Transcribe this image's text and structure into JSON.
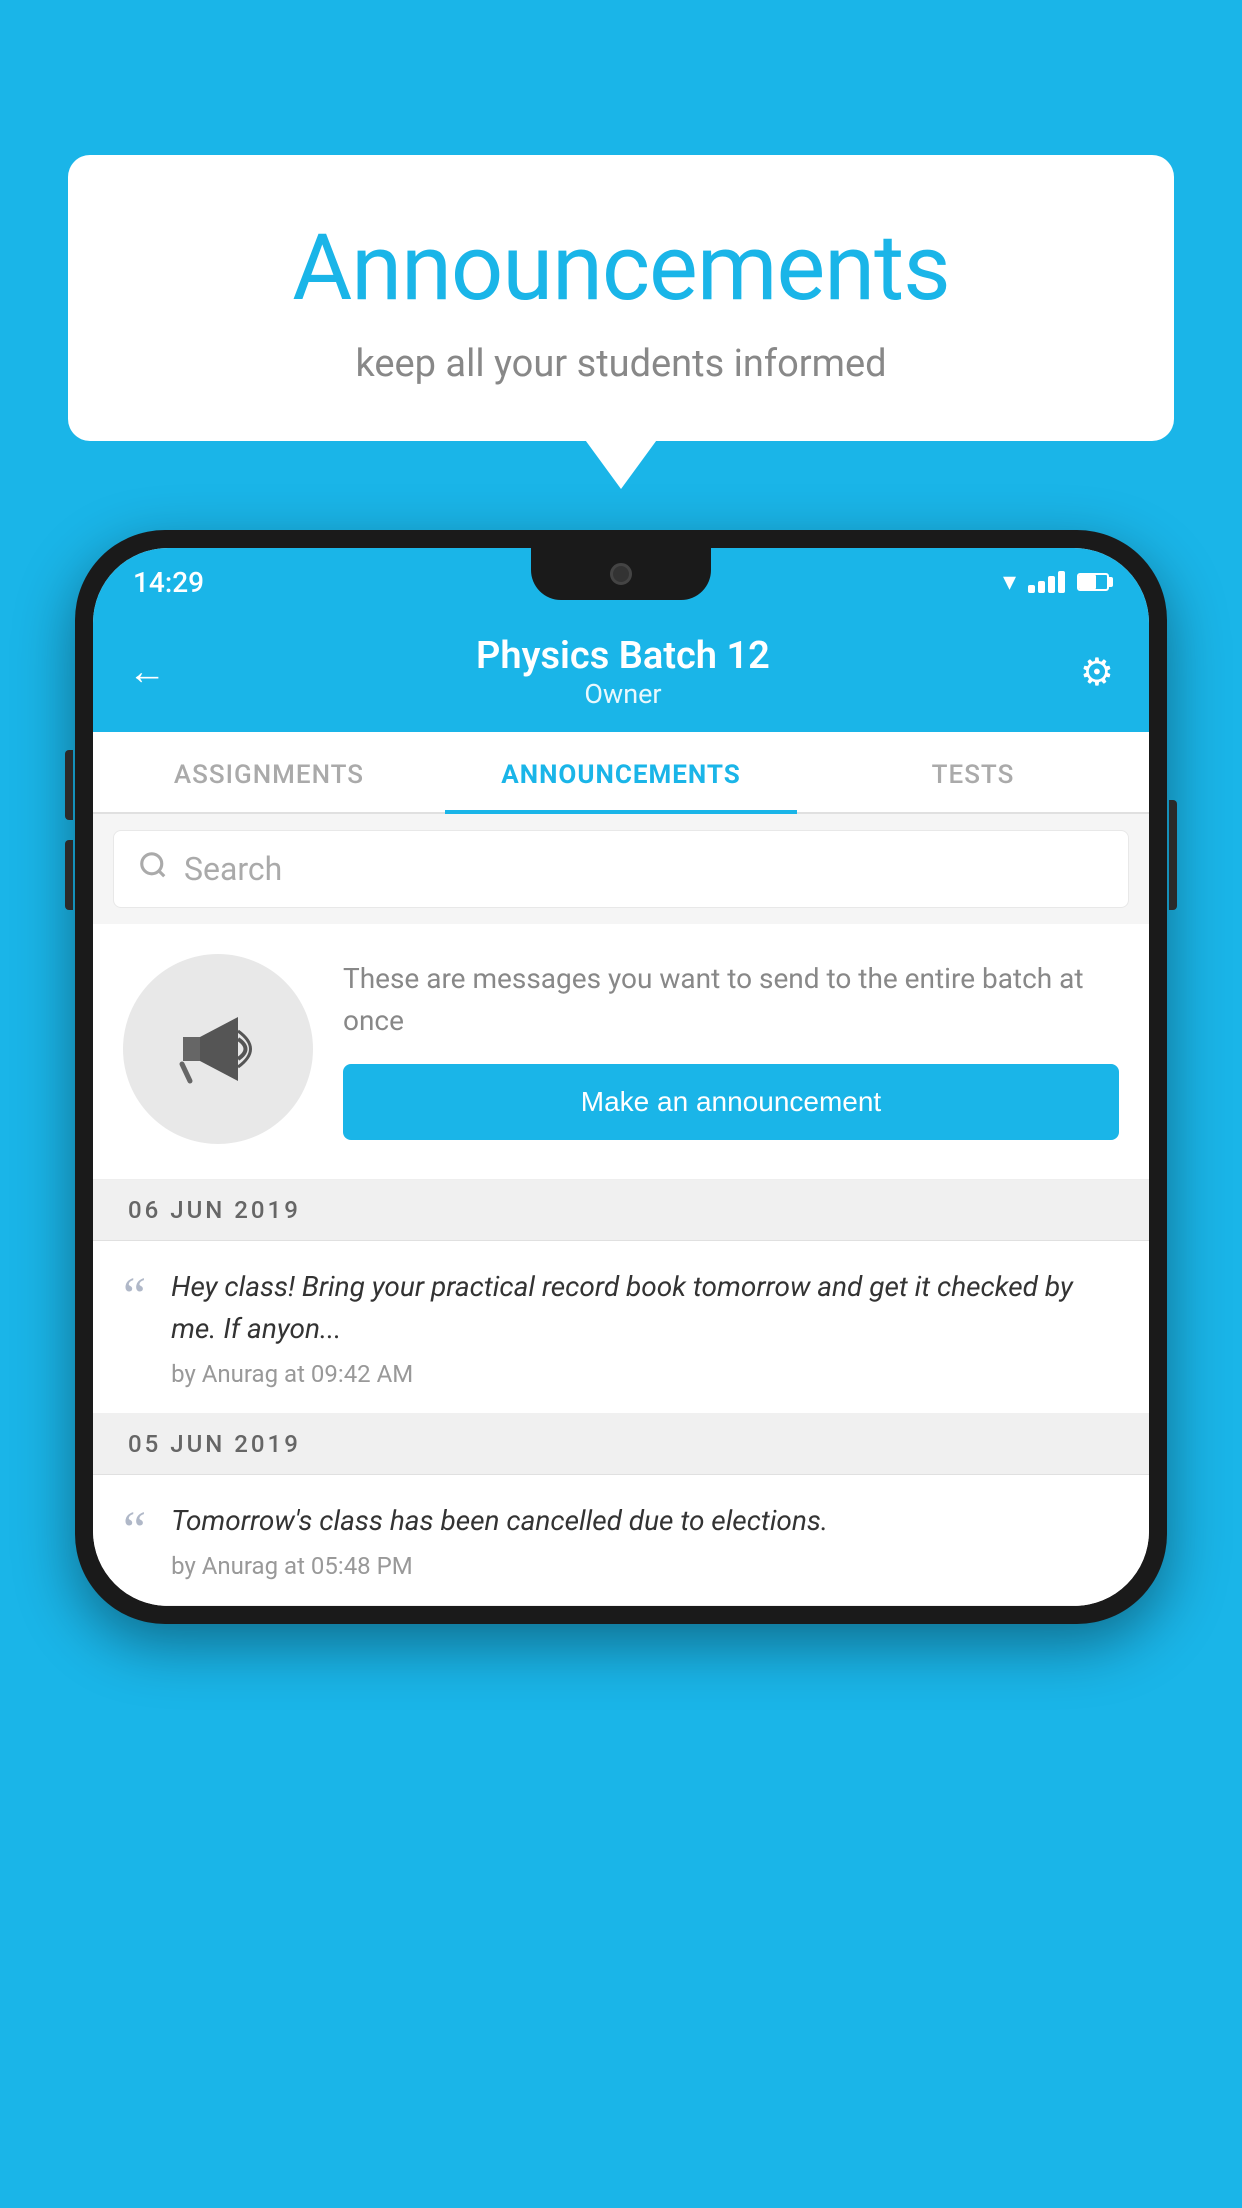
{
  "background_color": "#1ab5e8",
  "speech_bubble": {
    "title": "Announcements",
    "subtitle": "keep all your students informed"
  },
  "phone": {
    "status_bar": {
      "time": "14:29"
    },
    "header": {
      "title": "Physics Batch 12",
      "subtitle": "Owner",
      "back_label": "←",
      "settings_label": "⚙"
    },
    "tabs": [
      {
        "label": "ASSIGNMENTS",
        "active": false
      },
      {
        "label": "ANNOUNCEMENTS",
        "active": true
      },
      {
        "label": "TESTS",
        "active": false
      }
    ],
    "search": {
      "placeholder": "Search"
    },
    "announcement_prompt": {
      "description": "These are messages you want to send to the entire batch at once",
      "button_label": "Make an announcement"
    },
    "announcements": [
      {
        "date": "06  JUN  2019",
        "text": "Hey class! Bring your practical record book tomorrow and get it checked by me. If anyon...",
        "meta": "by Anurag at 09:42 AM"
      },
      {
        "date": "05  JUN  2019",
        "text": "Tomorrow's class has been cancelled due to elections.",
        "meta": "by Anurag at 05:48 PM"
      }
    ]
  }
}
